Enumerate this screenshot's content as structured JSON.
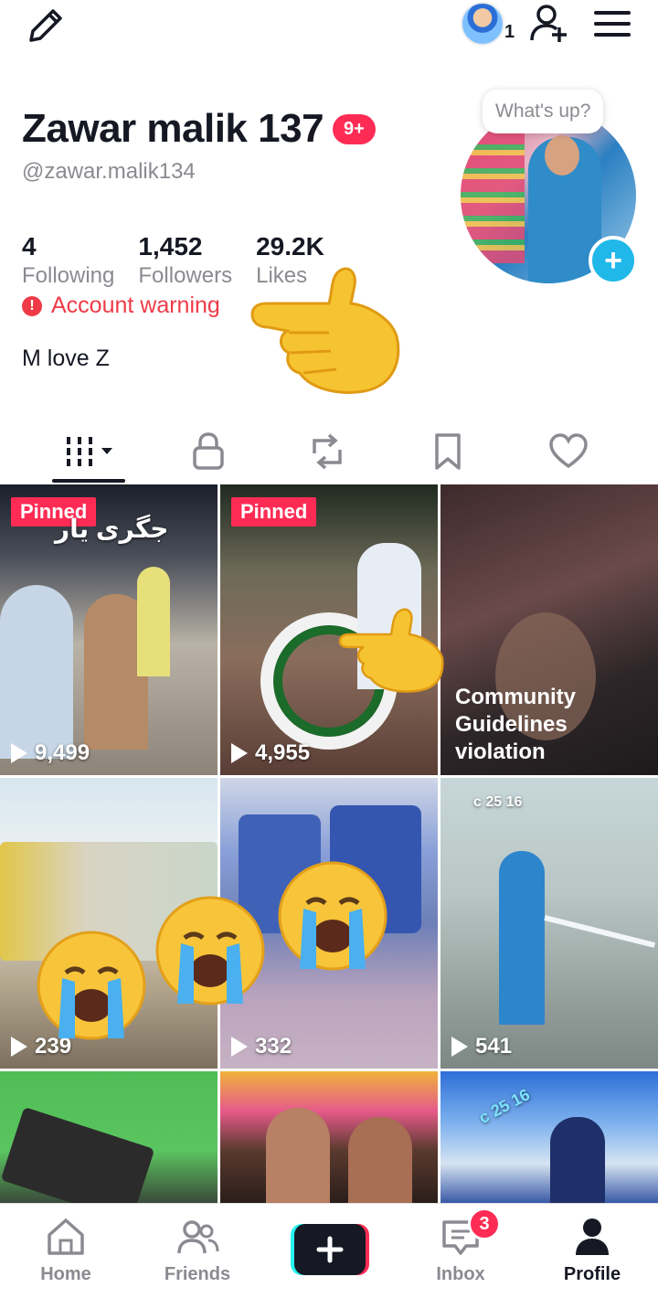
{
  "header": {
    "avatar_count": "1"
  },
  "profile": {
    "name": "Zawar malik 137",
    "notification_badge": "9+",
    "username": "@zawar.malik134",
    "status_placeholder": "What's up?",
    "stats": [
      {
        "value": "4",
        "label": "Following"
      },
      {
        "value": "1,452",
        "label": "Followers"
      },
      {
        "value": "29.2K",
        "label": "Likes"
      }
    ],
    "warning": "Account warning",
    "bio": "M love Z"
  },
  "tabs": [
    "videos-tab",
    "private-tab",
    "reposts-tab",
    "favorites-tab",
    "liked-tab"
  ],
  "videos": [
    {
      "pinned_label": "Pinned",
      "views": "9,499",
      "caption": "جگری یار"
    },
    {
      "pinned_label": "Pinned",
      "views": "4,955"
    },
    {
      "notice": [
        "Community",
        "Guidelines",
        "violation"
      ]
    },
    {
      "views": "239"
    },
    {
      "views": "332"
    },
    {
      "views": "541",
      "caption": "c 25 16"
    },
    {},
    {},
    {
      "caption": "c 25 16"
    }
  ],
  "nav": {
    "home": "Home",
    "friends": "Friends",
    "inbox": "Inbox",
    "inbox_badge": "3",
    "profile": "Profile"
  },
  "colors": {
    "accent": "#fe2c55",
    "warning": "#ef3b47",
    "cyan": "#20b8e9",
    "text": "#161823",
    "muted": "#8a8b91"
  }
}
